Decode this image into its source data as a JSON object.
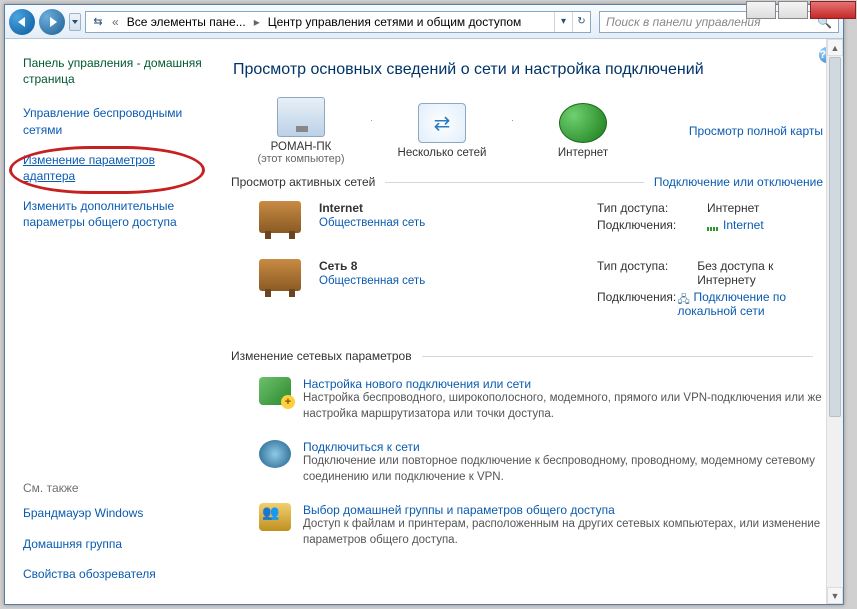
{
  "breadcrumb": {
    "seg1": "Все элементы пане...",
    "seg2": "Центр управления сетями и общим доступом"
  },
  "search": {
    "placeholder": "Поиск в панели управления"
  },
  "sidebar": {
    "home": "Панель управления - домашняя страница",
    "links": [
      "Управление беспроводными сетями",
      "Изменение параметров адаптера",
      "Изменить дополнительные параметры общего доступа"
    ],
    "seealso_label": "См. также",
    "seealso": [
      "Брандмауэр Windows",
      "Домашняя группа",
      "Свойства обозревателя"
    ]
  },
  "page": {
    "title": "Просмотр основных сведений о сети и настройка подключений",
    "map": {
      "pc_name": "РОМАН-ПК",
      "pc_sub": "(этот компьютер)",
      "mid": "Несколько сетей",
      "right": "Интернет",
      "full_map_link": "Просмотр полной карты"
    },
    "active_label": "Просмотр активных сетей",
    "connect_link": "Подключение или отключение",
    "networks": [
      {
        "name": "Internet",
        "type": "Общественная сеть",
        "access_label": "Тип доступа:",
        "access_value": "Интернет",
        "conn_label": "Подключения:",
        "conn_value": "Internet",
        "conn_icon": "signal"
      },
      {
        "name": "Сеть  8",
        "type": "Общественная сеть",
        "access_label": "Тип доступа:",
        "access_value": "Без доступа к Интернету",
        "conn_label": "Подключения:",
        "conn_value": "Подключение по локальной сети",
        "conn_icon": "plug"
      }
    ],
    "change_label": "Изменение сетевых параметров",
    "settings": [
      {
        "title": "Настройка нового подключения или сети",
        "desc": "Настройка беспроводного, широкополосного, модемного, прямого или VPN-подключения или же настройка маршрутизатора или точки доступа."
      },
      {
        "title": "Подключиться к сети",
        "desc": "Подключение или повторное подключение к беспроводному, проводному, модемному сетевому соединению или подключение к VPN."
      },
      {
        "title": "Выбор домашней группы и параметров общего доступа",
        "desc": "Доступ к файлам и принтерам, расположенным на других сетевых компьютерах, или изменение параметров общего доступа."
      }
    ]
  }
}
